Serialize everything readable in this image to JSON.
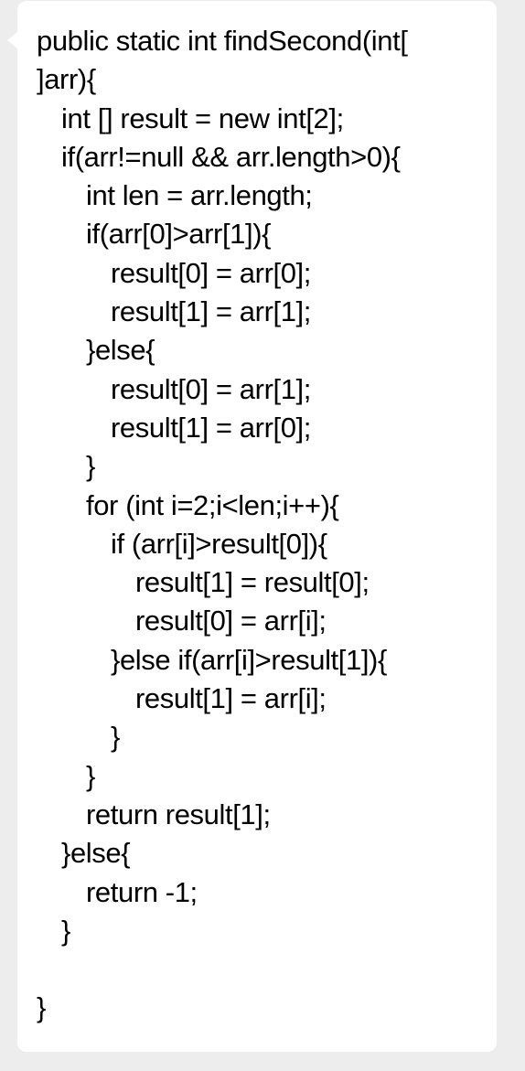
{
  "message": {
    "lines": [
      {
        "text": "public static int findSecond(int[",
        "indent": 0
      },
      {
        "text": "]arr){",
        "indent": 0
      },
      {
        "text": "int [] result = new int[2];",
        "indent": 1
      },
      {
        "text": "if(arr!=null && arr.length>0){",
        "indent": 1
      },
      {
        "text": "int len = arr.length;",
        "indent": 2
      },
      {
        "text": "if(arr[0]>arr[1]){",
        "indent": 2
      },
      {
        "text": "result[0] = arr[0];",
        "indent": 3
      },
      {
        "text": "result[1] = arr[1];",
        "indent": 3
      },
      {
        "text": "}else{",
        "indent": 2
      },
      {
        "text": "result[0] = arr[1];",
        "indent": 3
      },
      {
        "text": "result[1] = arr[0];",
        "indent": 3
      },
      {
        "text": "}",
        "indent": 2
      },
      {
        "text": "for (int i=2;i<len;i++){",
        "indent": 2
      },
      {
        "text": "if (arr[i]>result[0]){",
        "indent": 3
      },
      {
        "text": "result[1] = result[0];",
        "indent": 4
      },
      {
        "text": "result[0] = arr[i];",
        "indent": 4
      },
      {
        "text": "}else if(arr[i]>result[1]){",
        "indent": 3
      },
      {
        "text": "result[1] = arr[i];",
        "indent": 4
      },
      {
        "text": "}",
        "indent": 3
      },
      {
        "text": "}",
        "indent": 2
      },
      {
        "text": "return result[1];",
        "indent": 2
      },
      {
        "text": "}else{",
        "indent": 1
      },
      {
        "text": "return -1;",
        "indent": 2
      },
      {
        "text": "}",
        "indent": 1
      },
      {
        "text": "",
        "indent": 0
      },
      {
        "text": "}",
        "indent": 0
      }
    ]
  }
}
